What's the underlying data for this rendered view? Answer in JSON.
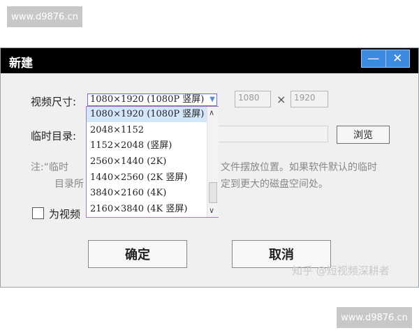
{
  "watermark": "www.d9876.cn",
  "window": {
    "title": "新建",
    "min_icon": "—",
    "close_icon": "✕"
  },
  "video_size": {
    "label": "视频尺寸:",
    "selected": "1080×1920 (1080P 竖屏)",
    "width": "1080",
    "times": "×",
    "height": "1920",
    "options": [
      "1080×1920 (1080P 竖屏)",
      "2048×1152",
      "1152×2048 (竖屏)",
      "2560×1440 (2K)",
      "1440×2560 (2K 竖屏)",
      "3840×2160 (4K)",
      "2160×3840 (4K 竖屏)"
    ]
  },
  "temp_dir": {
    "label": "临时目录:",
    "browse": "浏览"
  },
  "note": {
    "line1_a": "注:“临时",
    "line1_b": "文件摆放位置。如果软件默认的临时",
    "line2_a": "目录所",
    "line2_b": "定到更大的磁盘空间处。"
  },
  "checkbox_label": "为视频",
  "buttons": {
    "ok": "确定",
    "cancel": "取消"
  },
  "zhihu_watermark": "知乎 @短视频深耕者"
}
